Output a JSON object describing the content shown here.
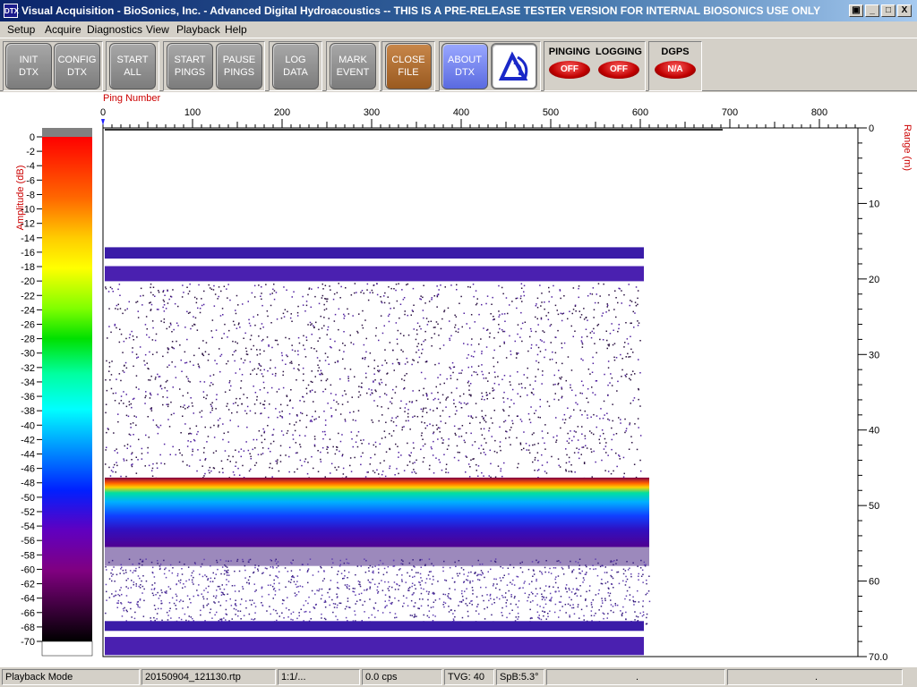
{
  "window": {
    "title": "Visual Acquisition  -  BioSonics, Inc.  -  Advanced Digital Hydroacoustics  -- THIS IS A PRE-RELEASE TESTER VERSION FOR INTERNAL BIOSONICS USE ONLY",
    "icon_text": "DTX",
    "restore_icon": "restore-icon",
    "minimize_glyph": "_",
    "maximize_glyph": "□",
    "close_glyph": "X"
  },
  "menu": [
    "Setup",
    "Acquire",
    "Diagnostics",
    "View",
    "Playback",
    "Help"
  ],
  "toolbar": {
    "init": "INIT\nDTX",
    "config": "CONFIG\nDTX",
    "start_all": "START\nALL",
    "start_pings": "START\nPINGS",
    "pause_pings": "PAUSE\nPINGS",
    "log_data": "LOG\nDATA",
    "mark_event": "MARK\nEVENT",
    "close_file": "CLOSE\nFILE",
    "about": "ABOUT\nDTX",
    "logo_icon": "biosonics-logo-icon"
  },
  "indicators": {
    "pinging": {
      "label": "PINGING",
      "value": "OFF"
    },
    "logging": {
      "label": "LOGGING",
      "value": "OFF"
    },
    "dgps": {
      "label": "DGPS",
      "value": "N/A"
    }
  },
  "echogram": {
    "x_axis_label": "Ping Number",
    "x_ticks": [
      "0",
      "100",
      "200",
      "300",
      "400",
      "500",
      "600",
      "700",
      "800"
    ],
    "amp_axis_label": "Amplitude (dB)",
    "amp_ticks": [
      "0",
      "-2",
      "-4",
      "-6",
      "-8",
      "-10",
      "-12",
      "-14",
      "-16",
      "-18",
      "-20",
      "-22",
      "-24",
      "-26",
      "-28",
      "-30",
      "-32",
      "-34",
      "-36",
      "-38",
      "-40",
      "-42",
      "-44",
      "-46",
      "-48",
      "-50",
      "-52",
      "-54",
      "-56",
      "-58",
      "-60",
      "-62",
      "-64",
      "-66",
      "-68",
      "-70"
    ],
    "range_axis_label": "Range (m)",
    "range_ticks": [
      "0",
      "10",
      "20",
      "30",
      "40",
      "50",
      "60",
      "70.0"
    ],
    "colors": {
      "axis_label": "#cc0000"
    }
  },
  "status": {
    "mode": "Playback Mode",
    "file": "20150904_121130.rtp",
    "ratio": "1:1/...",
    "cps": "0.0 cps",
    "tvg": "TVG: 40",
    "spb": "SpB:5.3°",
    "cell7": ".",
    "cell8": "."
  }
}
